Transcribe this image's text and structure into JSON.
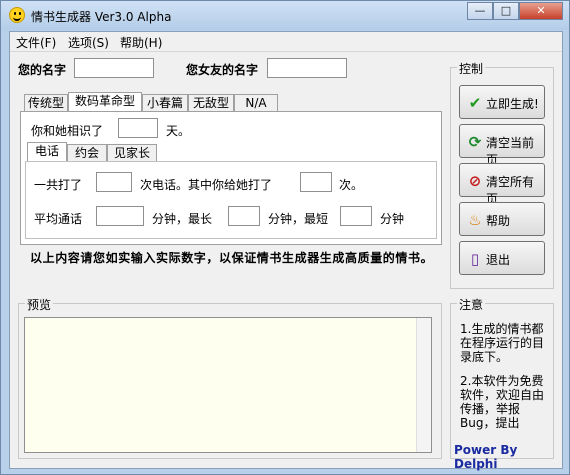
{
  "window": {
    "title": "情书生成器 Ver3.0 Alpha",
    "minimize": "—",
    "maximize": "□",
    "close": "✕"
  },
  "menu": {
    "file": "文件(F)",
    "options": "选项(S)",
    "help": "帮助(H)"
  },
  "names": {
    "your_name_label": "您的名字",
    "your_name_value": "",
    "girlfriend_label": "您女友的名字",
    "girlfriend_value": ""
  },
  "tabs": [
    "传统型",
    "数码革命型",
    "小春篇",
    "无敌型",
    "N/A"
  ],
  "active_tab": "数码革命型",
  "acquaint": {
    "prefix": "你和她相识了",
    "suffix": "天。",
    "value": ""
  },
  "subtabs": [
    "电话",
    "约会",
    "见家长"
  ],
  "call": {
    "line1_a": "一共打了",
    "line1_b": "次电话。其中你给她打了",
    "line1_c": "次。",
    "line2_a": "平均通话",
    "line2_b": "分钟，最长",
    "line2_c": "分钟，最短",
    "line2_d": "分钟"
  },
  "notice": "以上内容请您如实输入实际数字，以保证情书生成器生成高质量的情书。",
  "control": {
    "title": "控制",
    "buttons": [
      {
        "label": "立即生成!",
        "icon": "check-icon"
      },
      {
        "label": "清空当前页",
        "icon": "refresh-icon"
      },
      {
        "label": "清空所有页",
        "icon": "no-entry-icon"
      },
      {
        "label": "帮助",
        "icon": "help-icon"
      },
      {
        "label": "退出",
        "icon": "exit-door-icon"
      }
    ]
  },
  "preview": {
    "title": "预览",
    "content": ""
  },
  "notes": {
    "title": "注意",
    "p1": "1.生成的情书都在程序运行的目录底下。",
    "p2": "2.本软件为免费软件，欢迎自由传播，举报Bug，提出"
  },
  "powered_by": "Power By Delphi",
  "colors": {
    "title_gradient": "#b4cde8",
    "preview_bg": "#fffff0",
    "powered": "#1a2aa0"
  }
}
